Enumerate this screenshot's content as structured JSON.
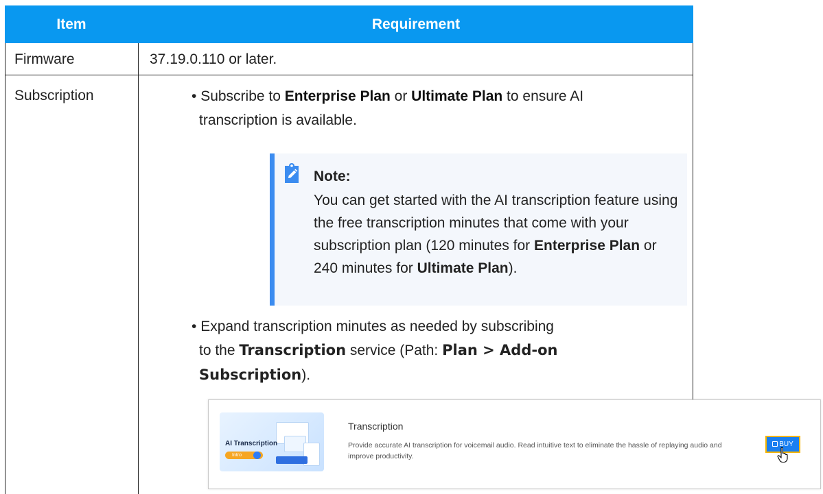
{
  "table": {
    "headers": [
      "Item",
      "Requirement"
    ],
    "rows": [
      {
        "item": "Firmware",
        "requirement": "37.19.0.110 or later."
      },
      {
        "item": "Subscription"
      }
    ]
  },
  "subscription": {
    "bullet1": {
      "marker": "•",
      "t1": " Subscribe to ",
      "b1": "Enterprise Plan",
      "t2": " or ",
      "b2": "Ultimate Plan",
      "t3": " to ensure AI",
      "line2": "transcription is available."
    },
    "note": {
      "title": "Note:",
      "t1": "You can get started with the AI transcription feature using the free transcription minutes that come with your subscription plan (120 minutes for ",
      "b1": "Enterprise Plan",
      "t2": " or 240 minutes for ",
      "b2": "Ultimate Plan",
      "t3": ")."
    },
    "bullet2": {
      "marker": "•",
      "line1": " Expand transcription minutes as needed by subscribing",
      "t1": "to the ",
      "b1": "Transcription",
      "t2": " service (Path: ",
      "b2": "Plan > Add-on",
      "b3": "Subscription",
      "t3": ")."
    }
  },
  "card": {
    "thumb_title": "AI Transcription",
    "thumb_pill": "Intro",
    "title": "Transcription",
    "description": "Provide accurate AI transcription for voicemail audio. Read intuitive text to eliminate the hassle of replaying audio and improve productivity.",
    "buy_label": "BUY"
  },
  "colors": {
    "header_bg": "#0998f0",
    "note_accent": "#3b8cf0",
    "note_bg": "#f4f7fc",
    "buy_bg": "#1a7ff0",
    "buy_border": "#f5b400"
  },
  "icons": {
    "note": "pencil-clipboard-icon",
    "buy": "shopping-bag-icon",
    "cursor": "hand-pointer-icon"
  }
}
